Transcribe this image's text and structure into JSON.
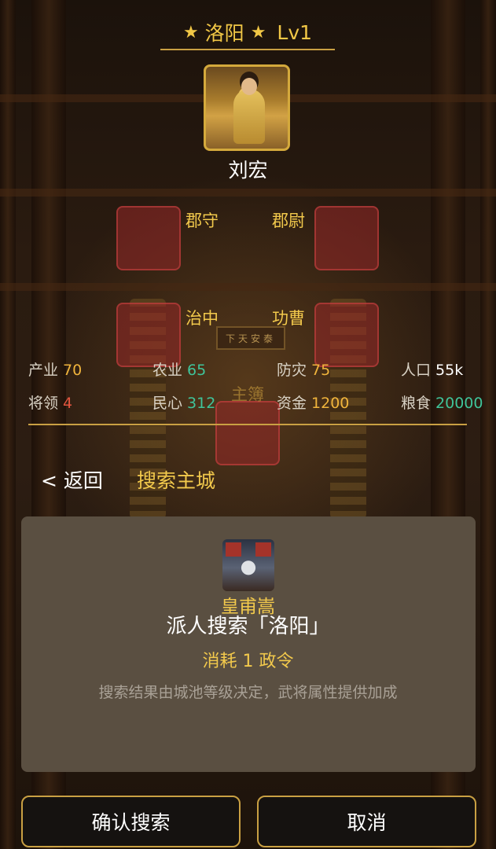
{
  "header": {
    "star_left": "★",
    "city": "洛阳",
    "star_right": "★",
    "level": "Lv1"
  },
  "ruler": {
    "name": "刘宏"
  },
  "officials": {
    "junshou": "郡守",
    "junwei": "郡尉",
    "zhizhong": "治中",
    "gongcao": "功曹",
    "zhubu": "主簿"
  },
  "background": {
    "plaque": "下天安泰"
  },
  "stats": {
    "industry": {
      "label": "产业",
      "value": "70"
    },
    "agriculture": {
      "label": "农业",
      "value": "65"
    },
    "defense": {
      "label": "防灾",
      "value": "75"
    },
    "population": {
      "label": "人口",
      "value": "55k"
    },
    "generals": {
      "label": "将领",
      "value": "4"
    },
    "morale": {
      "label": "民心",
      "value": "312"
    },
    "funds": {
      "label": "资金",
      "value": "1200"
    },
    "food": {
      "label": "粮食",
      "value": "20000"
    }
  },
  "colors": {
    "gold": "#f2c94c",
    "orange": "#f0b43c",
    "green": "#3fc49a",
    "red": "#e2553f",
    "white": "#ffffff",
    "panel": "#5a4f41",
    "slot": "#963232"
  },
  "nav": {
    "back": "< 返回",
    "crumb": "搜索主城"
  },
  "dialog": {
    "general_name": "皇甫嵩",
    "title": "派人搜索「洛阳」",
    "cost": "消耗 1 政令",
    "hint": "搜索结果由城池等级决定，武将属性提供加成"
  },
  "buttons": {
    "confirm": "确认搜索",
    "cancel": "取消"
  }
}
